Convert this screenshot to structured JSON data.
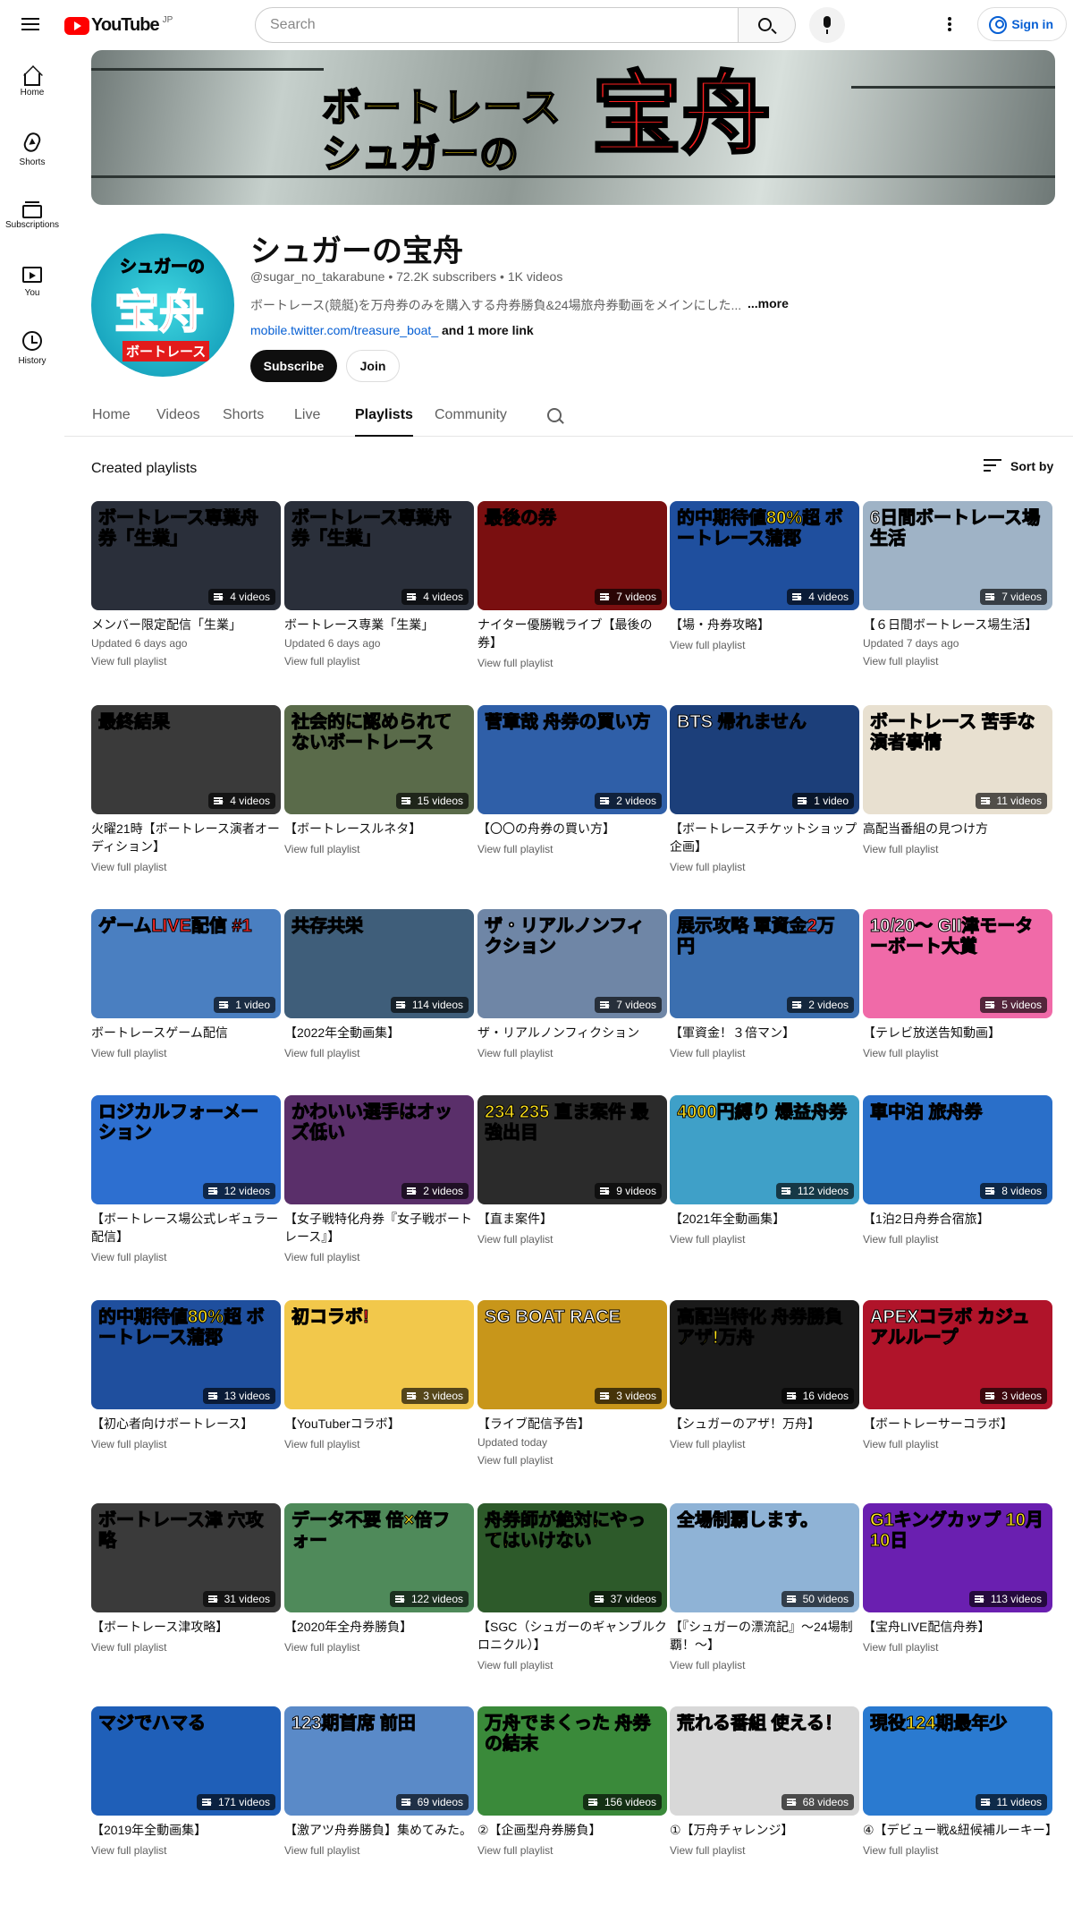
{
  "header": {
    "logo_text": "YouTube",
    "logo_region": "JP",
    "search_placeholder": "Search",
    "signin_label": "Sign in"
  },
  "sidebar": {
    "items": [
      {
        "label": "Home",
        "icon": "home-icon"
      },
      {
        "label": "Shorts",
        "icon": "shorts-icon"
      },
      {
        "label": "Subscriptions",
        "icon": "subscriptions-icon"
      },
      {
        "label": "You",
        "icon": "you-icon"
      },
      {
        "label": "History",
        "icon": "history-icon"
      }
    ]
  },
  "banner": {
    "line1": "ボートレース",
    "line2": "シュガーの",
    "line3": "宝舟"
  },
  "avatar": {
    "top": "シュガーの",
    "mid": "宝舟",
    "bottom": "ボートレース"
  },
  "channel": {
    "name": "シュガーの宝舟",
    "meta": "@sugar_no_takarabune • 72.2K subscribers • 1K videos",
    "description": "ボートレース(競艇)を万舟券のみを購入する舟券勝負&24場旅舟券動画をメインにした...",
    "more": "...more",
    "link": "mobile.twitter.com/treasure_boat_",
    "more_links": "and 1 more link",
    "subscribe_label": "Subscribe",
    "join_label": "Join"
  },
  "tabs": [
    "Home",
    "Videos",
    "Shorts",
    "Live",
    "Playlists",
    "Community"
  ],
  "active_tab": "Playlists",
  "section": {
    "title": "Created playlists",
    "sort_label": "Sort by"
  },
  "view_label": "View full playlist",
  "colors": {
    "brand_red": "#ff0000",
    "link_blue": "#065fd4",
    "text_secondary": "#606060"
  },
  "playlists": [
    {
      "title": "メンバー限定配信「生業」",
      "count": "4 videos",
      "updated": "Updated 6 days ago",
      "thumb_text": "ボートレース専業舟券「生業」",
      "bg": "#2a2f3a",
      "fg": "#ffffff"
    },
    {
      "title": "ボートレース専業「生業」",
      "count": "4 videos",
      "updated": "Updated 6 days ago",
      "thumb_text": "ボートレース専業舟券「生業」",
      "bg": "#2a2f3a",
      "fg": "#ffffff"
    },
    {
      "title": "ナイター優勝戦ライブ【最後の券】",
      "count": "7 videos",
      "updated": "",
      "thumb_text": "最後の券",
      "bg": "#7a0f10",
      "fg": "#ffd21a"
    },
    {
      "title": "【場・舟券攻略】",
      "count": "4 videos",
      "updated": "",
      "thumb_text": "的中期待値80%超 ボートレース蒲郡",
      "bg": "#1f4f9e",
      "fg": "#ffe21a"
    },
    {
      "title": "【６日間ボートレース場生活】",
      "count": "7 videos",
      "updated": "Updated 7 days ago",
      "thumb_text": "6日間ボートレース場生活",
      "bg": "#9fb3c6",
      "fg": "#ffffff"
    },
    {
      "title": "火曜21時【ボートレース演者オーディション】",
      "count": "4 videos",
      "updated": "",
      "thumb_text": "最終結果",
      "bg": "#3a3a3a",
      "fg": "#ff2a2a"
    },
    {
      "title": "【ボートレースルネタ】",
      "count": "15 videos",
      "updated": "",
      "thumb_text": "社会的に認められてないボートレース",
      "bg": "#5a6b4a",
      "fg": "#ffe21a"
    },
    {
      "title": "【〇〇の舟券の買い方】",
      "count": "2 videos",
      "updated": "",
      "thumb_text": "菅章哉 舟券の買い方",
      "bg": "#2f5fa8",
      "fg": "#ffffff"
    },
    {
      "title": "【ボートレースチケットショップ企画】",
      "count": "1 video",
      "updated": "",
      "thumb_text": "BTS 帰れません",
      "bg": "#1c3f7a",
      "fg": "#ffffff"
    },
    {
      "title": "高配当番組の見つけ方",
      "count": "11 videos",
      "updated": "",
      "thumb_text": "ボートレース 苦手な演者事情",
      "bg": "#e8e0d0",
      "fg": "#ff2a2a"
    },
    {
      "title": "ボートレースゲーム配信",
      "count": "1 video",
      "updated": "",
      "thumb_text": "ゲームLIVE配信 #1",
      "bg": "#4a7fc1",
      "fg": "#ff2a2a"
    },
    {
      "title": "【2022年全動画集】",
      "count": "114 videos",
      "updated": "",
      "thumb_text": "共存共栄",
      "bg": "#3f5e7a",
      "fg": "#ffe21a"
    },
    {
      "title": "ザ・リアルノンフィクション",
      "count": "7 videos",
      "updated": "",
      "thumb_text": "ザ・リアルノンフィクション",
      "bg": "#6f86a6",
      "fg": "#ffffff"
    },
    {
      "title": "【軍資金！３倍マン】",
      "count": "2 videos",
      "updated": "",
      "thumb_text": "展示攻略 軍資金2万円",
      "bg": "#3b6fb0",
      "fg": "#ff2a2a"
    },
    {
      "title": "【テレビ放送告知動画】",
      "count": "5 videos",
      "updated": "",
      "thumb_text": "10/20〜 GII津モーターボート大賞",
      "bg": "#f06aa8",
      "fg": "#ffffff"
    },
    {
      "title": "【ボートレース場公式レギュラー配信】",
      "count": "12 videos",
      "updated": "",
      "thumb_text": "ロジカルフォーメーション",
      "bg": "#2d6fd0",
      "fg": "#ffffff"
    },
    {
      "title": "【女子戦特化舟券『女子戦ボートレース』】",
      "count": "2 videos",
      "updated": "",
      "thumb_text": "かわいい選手はオッズ低い",
      "bg": "#5a2f6a",
      "fg": "#ffe21a"
    },
    {
      "title": "【直ま案件】",
      "count": "9 videos",
      "updated": "",
      "thumb_text": "234 235 直ま案件 最強出目",
      "bg": "#2b2b2b",
      "fg": "#ffe21a"
    },
    {
      "title": "【2021年全動画集】",
      "count": "112 videos",
      "updated": "",
      "thumb_text": "4000円縛り 爆益舟券",
      "bg": "#3fa0c8",
      "fg": "#ffe21a"
    },
    {
      "title": "【1泊2日舟券合宿旅】",
      "count": "8 videos",
      "updated": "",
      "thumb_text": "車中泊 旅舟券",
      "bg": "#2a6fc9",
      "fg": "#ffe21a"
    },
    {
      "title": "【初心者向けボートレース】",
      "count": "13 videos",
      "updated": "",
      "thumb_text": "的中期待値80%超 ボートレース蒲郡",
      "bg": "#1f4f9e",
      "fg": "#ffe21a"
    },
    {
      "title": "【YouTuberコラボ】",
      "count": "3 videos",
      "updated": "",
      "thumb_text": "初コラボ!",
      "bg": "#f2c84b",
      "fg": "#ff2a2a"
    },
    {
      "title": "【ライブ配信予告】",
      "count": "3 videos",
      "updated": "Updated today",
      "thumb_text": "SG BOAT RACE",
      "bg": "#c8961a",
      "fg": "#ffffff"
    },
    {
      "title": "【シュガーのアザ！万舟】",
      "count": "16 videos",
      "updated": "",
      "thumb_text": "高配当特化 舟券勝負 アザ!万舟",
      "bg": "#1a1a1a",
      "fg": "#ffe21a"
    },
    {
      "title": "【ボートレーサーコラボ】",
      "count": "3 videos",
      "updated": "",
      "thumb_text": "APEXコラボ カジュアルループ",
      "bg": "#b0142a",
      "fg": "#ffffff"
    },
    {
      "title": "【ボートレース津攻略】",
      "count": "31 videos",
      "updated": "",
      "thumb_text": "ボートレース津 穴攻略",
      "bg": "#3a3a3a",
      "fg": "#ff2a2a"
    },
    {
      "title": "【2020年全舟券勝負】",
      "count": "122 videos",
      "updated": "",
      "thumb_text": "データ不要 倍×倍フォー",
      "bg": "#4f8a5a",
      "fg": "#ffe21a"
    },
    {
      "title": "【SGC（シュガーのギャンブルクロニクル）】",
      "count": "37 videos",
      "updated": "",
      "thumb_text": "舟券師が絶対にやってはいけない",
      "bg": "#2d5a2a",
      "fg": "#ffe21a"
    },
    {
      "title": "【『シュガーの漂流記』〜24場制覇！〜】",
      "count": "50 videos",
      "updated": "",
      "thumb_text": "全場制覇します。",
      "bg": "#8fb3d6",
      "fg": "#ff2a2a"
    },
    {
      "title": "【宝舟LIVE配信舟券】",
      "count": "113 videos",
      "updated": "",
      "thumb_text": "G1キングカップ 10月10日",
      "bg": "#6a1fb0",
      "fg": "#ffe21a"
    },
    {
      "title": "【2019年全動画集】",
      "count": "171 videos",
      "updated": "",
      "thumb_text": "マジでハマる",
      "bg": "#1f5fb8",
      "fg": "#ffe21a"
    },
    {
      "title": "【激アツ舟券勝負】集めてみた。",
      "count": "69 videos",
      "updated": "",
      "thumb_text": "123期首席 前田",
      "bg": "#5a8ac8",
      "fg": "#ffffff"
    },
    {
      "title": "②【企画型舟券勝負】",
      "count": "156 videos",
      "updated": "",
      "thumb_text": "万舟でまくった 舟券の結末",
      "bg": "#3a8a3a",
      "fg": "#ffe21a"
    },
    {
      "title": "①【万舟チャレンジ】",
      "count": "68 videos",
      "updated": "",
      "thumb_text": "荒れる番組 使える！",
      "bg": "#d8d8d8",
      "fg": "#ff2a2a"
    },
    {
      "title": "④【デビュー戦&紐候補ルーキー】",
      "count": "11 videos",
      "updated": "",
      "thumb_text": "現役124期最年少",
      "bg": "#2a7ad0",
      "fg": "#ffe21a"
    }
  ]
}
